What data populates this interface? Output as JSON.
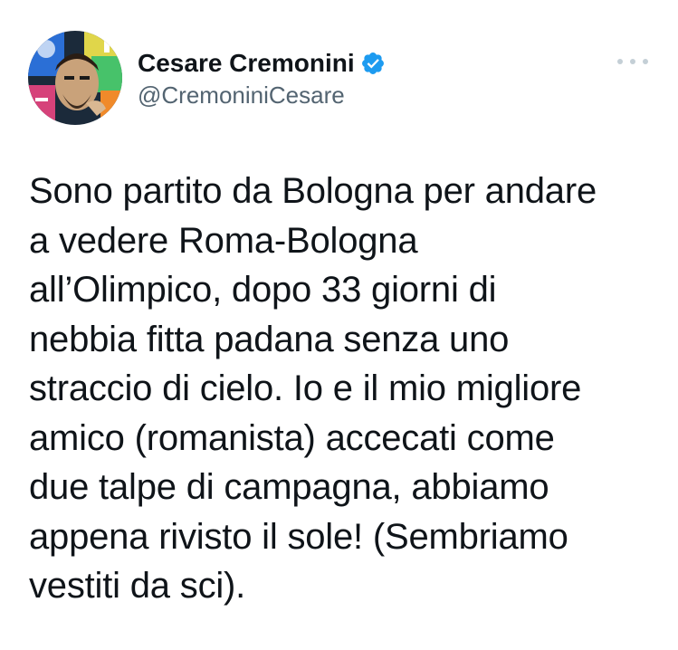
{
  "author": {
    "display_name": "Cesare Cremonini",
    "handle": "@CremoniniCesare",
    "verified": true,
    "avatar_icon": "profile-photo-avatar"
  },
  "tweet": {
    "lines": [
      "Sono partito da Bologna per andare",
      "a vedere Roma-Bologna",
      "all’Olimpico, dopo 33 giorni di",
      "nebbia fitta padana senza uno",
      "straccio di cielo. Io e il mio migliore",
      "amico (romanista) accecati come",
      "due talpe di campagna, abbiamo",
      "appena rivisto il sole! (Sembriamo",
      "vestiti da sci)."
    ]
  },
  "icons": {
    "verified": "verified-badge-icon",
    "more": "more-options-icon"
  },
  "colors": {
    "text_primary": "#0f1419",
    "text_secondary": "#536471",
    "verified_blue": "#1d9bf0",
    "more_dots": "#c4cfd6",
    "background": "#ffffff"
  }
}
